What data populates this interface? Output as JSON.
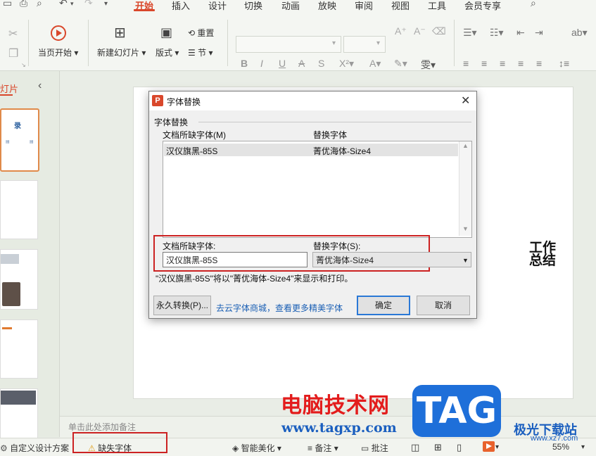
{
  "menubar": {
    "tabs": [
      "开始",
      "插入",
      "设计",
      "切换",
      "动画",
      "放映",
      "审阅",
      "视图",
      "工具",
      "会员专享"
    ]
  },
  "ribbon": {
    "start_slide": "当页开始",
    "new_slide": "新建幻灯片",
    "layout": "版式",
    "reset": "重置",
    "section": "节"
  },
  "left_panel": {
    "tab_label": "灯片",
    "thumb1_title": "录"
  },
  "slide": {
    "right_text": "工作\n总结"
  },
  "notes": {
    "placeholder": "单击此处添加备注"
  },
  "statusbar": {
    "custom_design": "自定义设计方案",
    "missing_fonts": "缺失字体",
    "smart_beautify": "智能美化",
    "notes": "备注",
    "comments": "批注",
    "zoom": "55%"
  },
  "dialog": {
    "title": "字体替换",
    "group_label": "字体替换",
    "col_missing": "文档所缺字体(M)",
    "col_replace": "替换字体",
    "list_rows": [
      {
        "missing": "汉仪旗黑-85S",
        "replace": "菁优海体-Size4"
      }
    ],
    "missing_label": "文档所缺字体:",
    "replace_label": "替换字体(S):",
    "missing_value": "汉仪旗黑-85S",
    "replace_value": "菁优海体-Size4",
    "note": "\"汉仪旗黑-85S\"将以\"菁优海体-Size4\"来显示和打印。",
    "permanent_button": "永久转换(P)...",
    "store_link": "去云字体商城，查看更多精美字体",
    "ok_button": "确定",
    "cancel_button": "取消"
  },
  "watermark": {
    "line1": "电脑技术网",
    "line2": "www.tagxp.com",
    "tag": "TAG",
    "site": "极光下载站",
    "url": "www.xz7.com"
  },
  "colors": {
    "accent": "#d9472b",
    "highlight_box": "#cc2222",
    "link": "#1a5fb4"
  }
}
